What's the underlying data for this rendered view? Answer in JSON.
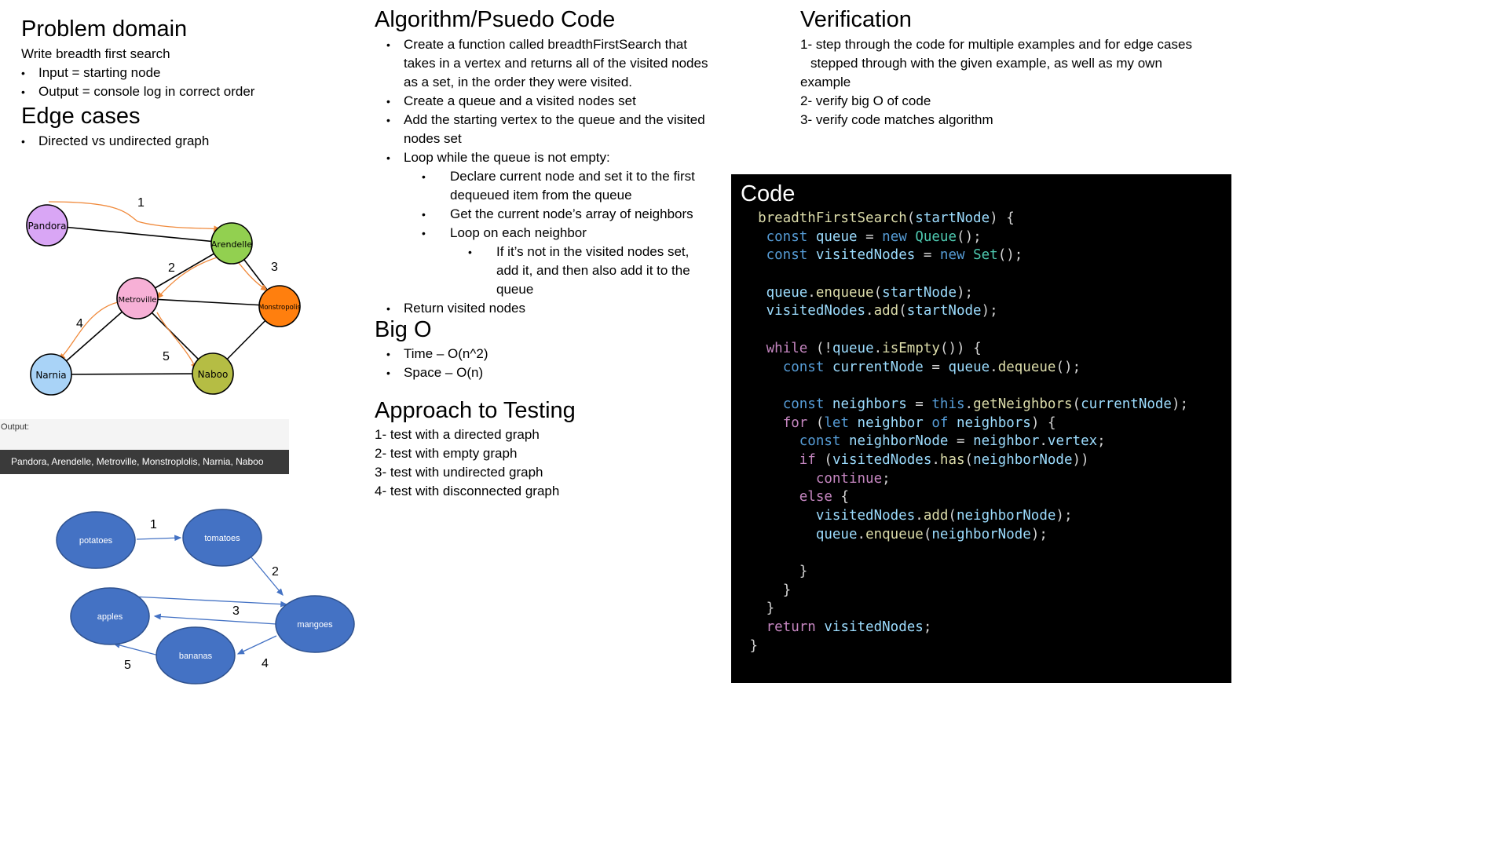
{
  "problem": {
    "title": "Problem domain",
    "description": "Write breadth first search",
    "bullets": [
      "Input = starting node",
      "Output = console log in correct order"
    ]
  },
  "edge_cases": {
    "title": "Edge cases",
    "bullets": [
      "Directed vs undirected graph"
    ]
  },
  "graph1": {
    "nodes": [
      "Pandora",
      "Arendelle",
      "Metroville",
      "Monstropolis",
      "Narnia",
      "Naboo"
    ],
    "steps": [
      "1",
      "2",
      "3",
      "4",
      "5"
    ],
    "colors": {
      "Pandora": "#d9a6f5",
      "Arendelle": "#92d050",
      "Metroville": "#f7b0d6",
      "Monstropolis": "#ff7f0e",
      "Narnia": "#a9d3f7",
      "Naboo": "#b5bd44"
    }
  },
  "output": {
    "label": "Output:",
    "value": "Pandora, Arendelle, Metroville, Monstroplolis, Narnia, Naboo"
  },
  "graph2": {
    "nodes": [
      "potatoes",
      "tomatoes",
      "mangoes",
      "apples",
      "bananas"
    ],
    "steps": [
      "1",
      "2",
      "3",
      "4",
      "5"
    ],
    "color": "#4472c4"
  },
  "algorithm": {
    "title": "Algorithm/Psuedo Code",
    "items": [
      "Create a function called breadthFirstSearch that takes in a vertex and returns all of the visited nodes as a set, in the order they were visited.",
      "Create a queue and a visited nodes set",
      "Add the starting vertex to the queue and the visited nodes set",
      "Loop while the queue is not empty:",
      "Declare current node and set it to the first dequeued item from the queue",
      "Get the current node’s array of neighbors",
      "Loop on each neighbor",
      "If it’s not in the visited nodes set, add it, and then also add it to the queue",
      "Return visited nodes"
    ]
  },
  "big_o": {
    "title": "Big O",
    "items": [
      "Time –  O(n^2)",
      "Space – O(n)"
    ]
  },
  "testing": {
    "title": "Approach to Testing",
    "items": [
      "1- test with a directed graph",
      "2- test with empty graph",
      "3- test with undirected graph",
      "4- test with disconnected graph"
    ]
  },
  "verification": {
    "title": "Verification",
    "items": [
      "1- step through the code for multiple examples and for edge cases",
      "stepped through with the given example, as well as my own",
      "example",
      "2- verify big O of code",
      "3- verify code matches algorithm"
    ]
  },
  "code": {
    "title": "Code",
    "lines": [
      "  breadthFirstSearch(startNode) {",
      "   const queue = new Queue();",
      "   const visitedNodes = new Set();",
      "",
      "   queue.enqueue(startNode);",
      "   visitedNodes.add(startNode);",
      "",
      "   while (!queue.isEmpty()) {",
      "     const currentNode = queue.dequeue();",
      "",
      "     const neighbors = this.getNeighbors(currentNode);",
      "     for (let neighbor of neighbors) {",
      "       const neighborNode = neighbor.vertex;",
      "       if (visitedNodes.has(neighborNode))",
      "         continue;",
      "       else {",
      "         visitedNodes.add(neighborNode);",
      "         queue.enqueue(neighborNode);",
      "",
      "       }",
      "     }",
      "   }",
      "   return visitedNodes;",
      " }"
    ]
  }
}
